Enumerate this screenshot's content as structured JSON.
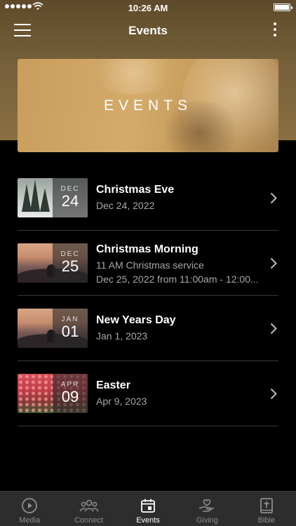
{
  "status_bar": {
    "time": "10:26 AM"
  },
  "nav": {
    "title": "Events",
    "menu_icon": "hamburger-menu-icon",
    "more_icon": "more-vertical-icon"
  },
  "banner": {
    "title": "EVENTS"
  },
  "events": [
    {
      "month": "DEC",
      "day": "24",
      "name": "Christmas Eve",
      "line1": "Dec 24, 2022",
      "line2": "",
      "thumb": "snowy-forest"
    },
    {
      "month": "DEC",
      "day": "25",
      "name": "Christmas Morning",
      "line1": "11 AM Christmas service",
      "line2": "Dec 25, 2022 from 11:00am - 12:00...",
      "thumb": "sunset-person"
    },
    {
      "month": "JAN",
      "day": "01",
      "name": "New Years Day",
      "line1": "Jan 1, 2023",
      "line2": "",
      "thumb": "sunset-person"
    },
    {
      "month": "APR",
      "day": "09",
      "name": "Easter",
      "line1": "Apr 9, 2023",
      "line2": "",
      "thumb": "tulip-field"
    }
  ],
  "tabs": [
    {
      "label": "Media",
      "icon": "play-circle-icon",
      "active": false
    },
    {
      "label": "Connect",
      "icon": "people-icon",
      "active": false
    },
    {
      "label": "Events",
      "icon": "calendar-icon",
      "active": true
    },
    {
      "label": "Giving",
      "icon": "heart-hand-icon",
      "active": false
    },
    {
      "label": "Bible",
      "icon": "bible-icon",
      "active": false
    }
  ]
}
